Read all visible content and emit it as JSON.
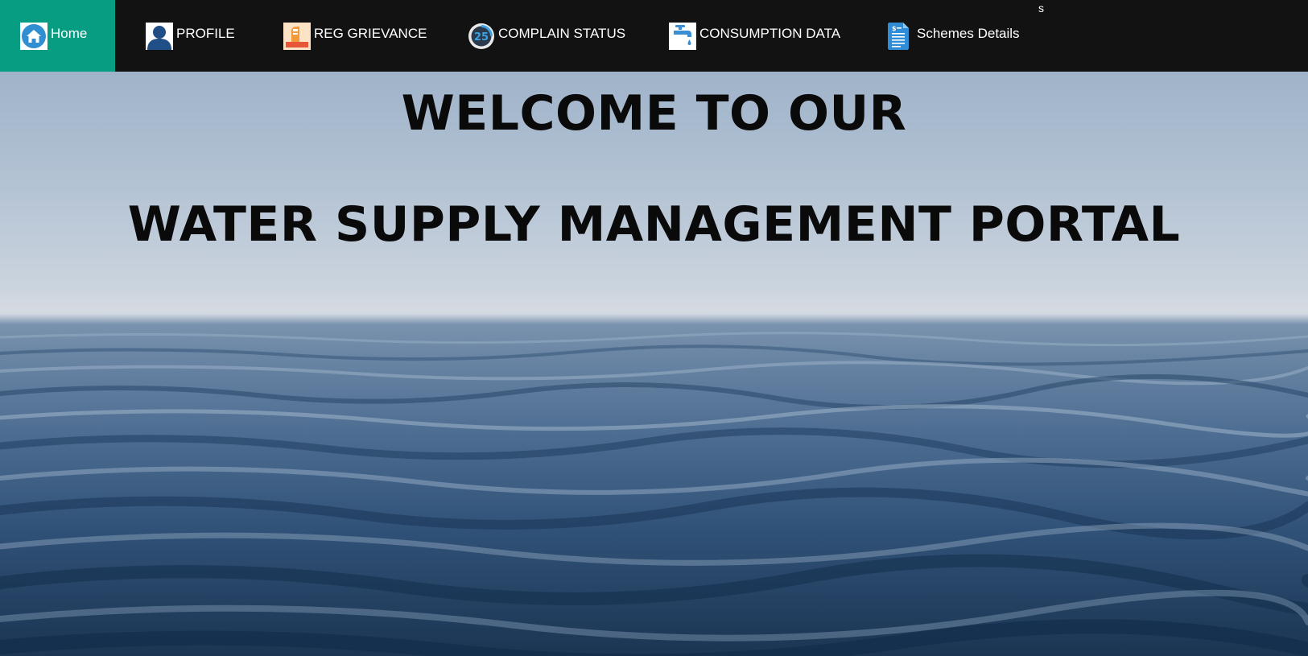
{
  "nav": {
    "items": [
      {
        "label": "Home",
        "icon": "home-icon",
        "active": true
      },
      {
        "label": "PROFILE",
        "icon": "profile-icon"
      },
      {
        "label": "REG GRIEVANCE",
        "icon": "grievance-icon"
      },
      {
        "label": "COMPLAIN STATUS",
        "icon": "status-dial-icon",
        "icon_text": "25"
      },
      {
        "label": "CONSUMPTION DATA",
        "icon": "water-tap-icon"
      },
      {
        "label": "Schemes Details",
        "icon": "document-icon"
      }
    ],
    "corner_text": "s"
  },
  "hero": {
    "title_line1": "WELCOME TO OUR",
    "title_line2": "WATER SUPPLY MANAGEMENT PORTAL"
  },
  "colors": {
    "nav_bg": "#121212",
    "active_bg": "#069d83",
    "title": "#0a0a0a"
  }
}
